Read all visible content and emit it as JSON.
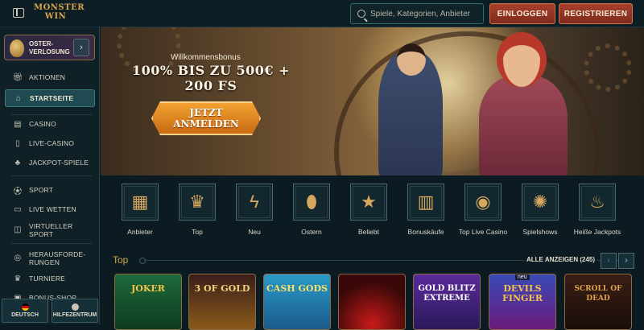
{
  "header": {
    "logo_text": "MONSTER WIN",
    "search_placeholder": "Spiele, Kategorien, Anbieter",
    "login_label": "EINLOGGEN",
    "register_label": "REGISTRIEREN"
  },
  "sidebar": {
    "promo_label": "OSTER-VERLOSUNG",
    "items": [
      {
        "label": "AKTIONEN",
        "icon": "gift-icon"
      },
      {
        "label": "STARTSEITE",
        "icon": "home-icon"
      },
      {
        "label": "CASINO",
        "icon": "slot-machine-icon"
      },
      {
        "label": "LIVE-CASINO",
        "icon": "cards-icon"
      },
      {
        "label": "JACKPOT-SPIELE",
        "icon": "clover-icon"
      },
      {
        "label": "SPORT",
        "icon": "ball-icon"
      },
      {
        "label": "LIVE WETTEN",
        "icon": "live-tv-icon"
      },
      {
        "label": "VIRTUELLER SPORT",
        "icon": "virtual-icon"
      },
      {
        "label": "HERAUSFORDE-RUNGEN",
        "icon": "challenge-icon"
      },
      {
        "label": "TURNIERE",
        "icon": "trophy-icon"
      },
      {
        "label": "BONUS-SHOP",
        "icon": "shop-icon"
      }
    ],
    "language_label": "DEUTSCH",
    "help_label": "HILFEZENTRUM"
  },
  "hero": {
    "subtitle": "Willkommensbonus",
    "title": "100% BIS ZU 500€ + 200 FS",
    "cta_line1": "JETZT",
    "cta_line2": "ANMELDEN"
  },
  "categories": [
    {
      "label": "Anbieter",
      "icon": "provider-book-icon"
    },
    {
      "label": "Top",
      "icon": "crown-icon"
    },
    {
      "label": "Neu",
      "icon": "lightning-icon"
    },
    {
      "label": "Ostern",
      "icon": "easter-egg-icon"
    },
    {
      "label": "Beliebt",
      "icon": "star-icon"
    },
    {
      "label": "Bonuskäufe",
      "icon": "chest-icon"
    },
    {
      "label": "Top Live Casino",
      "icon": "chip-crown-icon"
    },
    {
      "label": "Spielshows",
      "icon": "wheel-icon"
    },
    {
      "label": "Heiße Jackpots",
      "icon": "fire-icon"
    }
  ],
  "top_section": {
    "title": "Top",
    "see_all_label": "ALLE ANZEIGEN (245)"
  },
  "games": [
    {
      "title": "JOKER",
      "badge": ""
    },
    {
      "title": "3 OF GOLD",
      "badge": ""
    },
    {
      "title": "CASH GODS",
      "badge": ""
    },
    {
      "title": "",
      "badge": ""
    },
    {
      "title": "GOLD BLITZ EXTREME",
      "badge": ""
    },
    {
      "title": "DEVILS FINGER",
      "badge": "neu"
    },
    {
      "title": "SCROLL OF DEAD",
      "badge": ""
    }
  ]
}
